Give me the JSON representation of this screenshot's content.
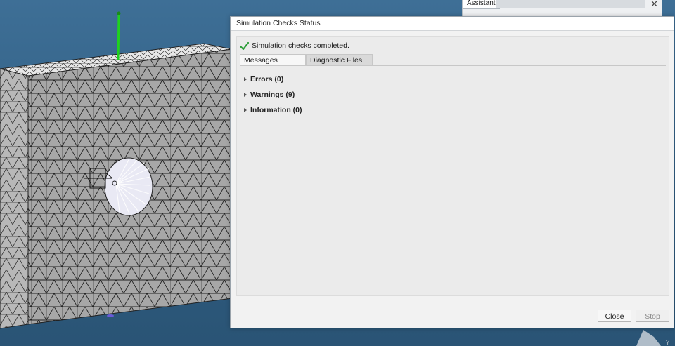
{
  "assistant": {
    "tab_label": "Assistant",
    "close_glyph": "✕"
  },
  "dialog": {
    "title": "Simulation Checks Status",
    "status_text": "Simulation checks completed.",
    "status_icon": "check-icon",
    "accent_check": "#2e9e3a",
    "tabs": [
      {
        "label": "Messages"
      },
      {
        "label": "Diagnostic Files"
      }
    ],
    "tree": [
      {
        "label": "Errors (0)"
      },
      {
        "label": "Warnings (9)"
      },
      {
        "label": "Information (0)"
      }
    ],
    "buttons": {
      "close": "Close",
      "stop": "Stop"
    }
  },
  "viewport": {
    "background": "#2f5d82",
    "mesh_color": "#9a9a9a",
    "axis_color": "#1fd11f"
  }
}
